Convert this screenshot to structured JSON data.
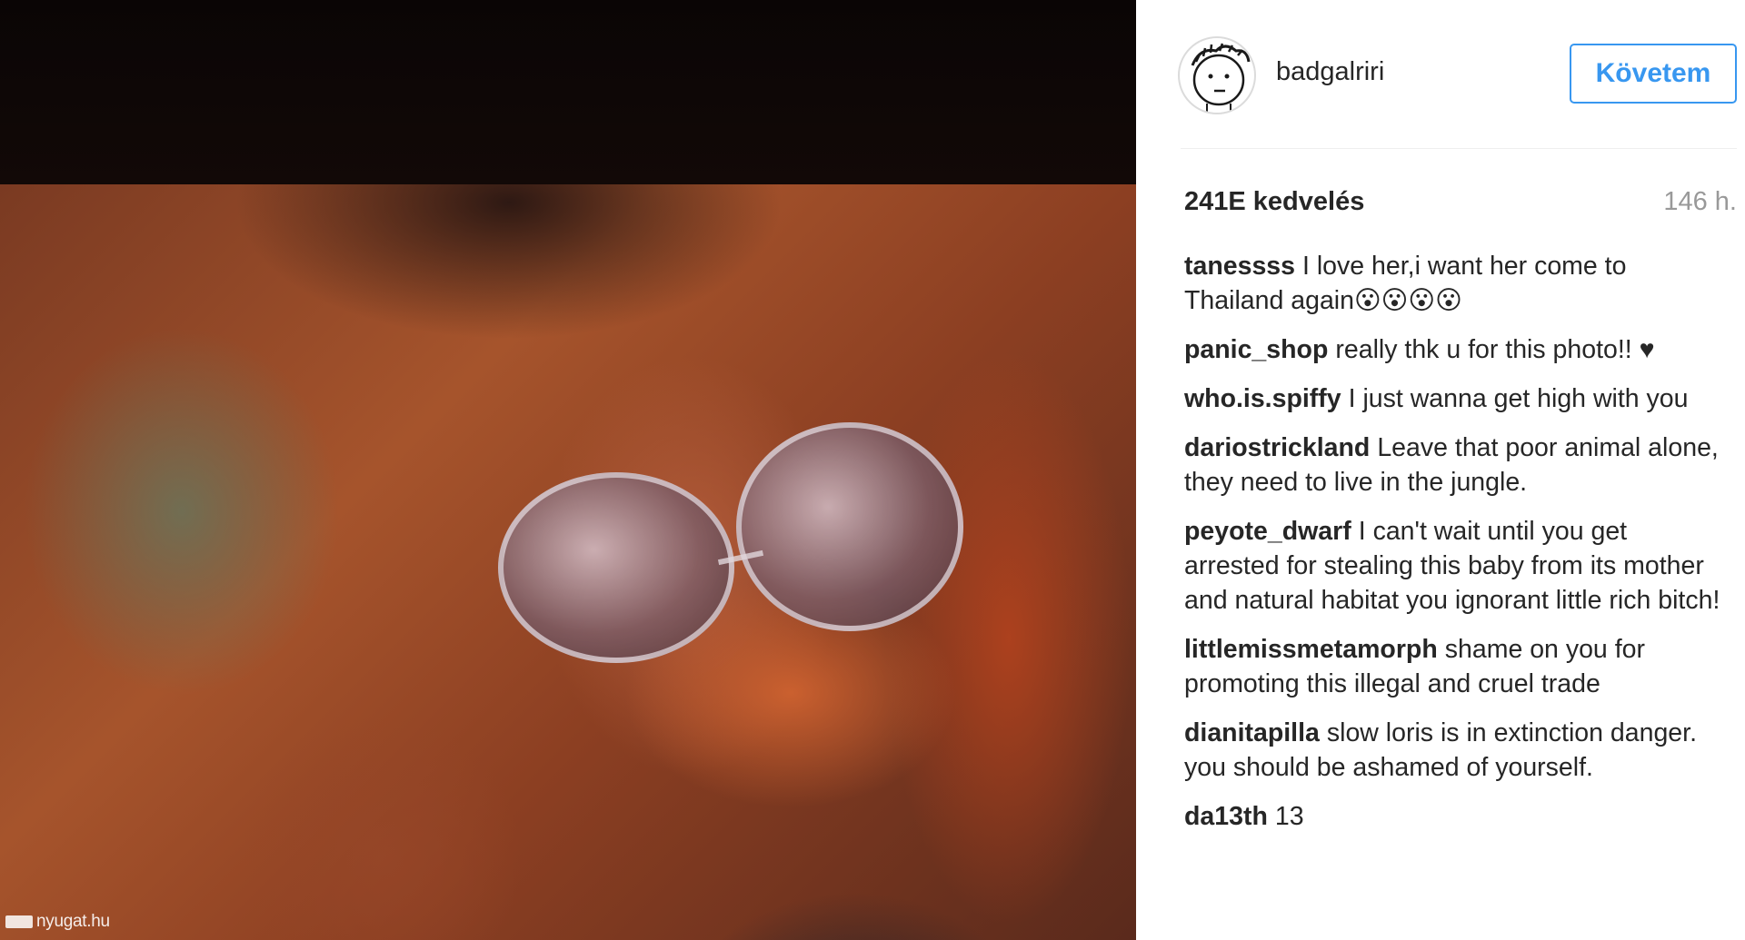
{
  "watermark": {
    "text": "nyugat.hu"
  },
  "post": {
    "username": "badgalriri",
    "follow_label": "Követem",
    "likes": "241E kedvelés",
    "time": "146 h."
  },
  "comments": [
    {
      "user": "tanessss",
      "text": "I love her,i want her come to Thailand again😮😮😮😮"
    },
    {
      "user": "panic_shop",
      "text": "really thk u for this photo!! ♥"
    },
    {
      "user": "who.is.spiffy",
      "text": "I just wanna get high with you"
    },
    {
      "user": "dariostrickland",
      "text": "Leave that poor animal alone, they need to live in the jungle."
    },
    {
      "user": "peyote_dwarf",
      "text": "I can't wait until you get arrested for stealing this baby from its mother and natural habitat you ignorant little rich bitch!"
    },
    {
      "user": "littlemissmetamorph",
      "text": "shame on you for promoting this illegal and cruel trade"
    },
    {
      "user": "dianitapilla",
      "text": "slow loris is in extinction danger. you should be ashamed of yourself."
    },
    {
      "user": "da13th",
      "text": "13"
    }
  ],
  "colors": {
    "accent": "#3897f0",
    "muted": "#999999",
    "text": "#262626"
  },
  "icons": {
    "avatar": "cartoon-face-avatar"
  }
}
